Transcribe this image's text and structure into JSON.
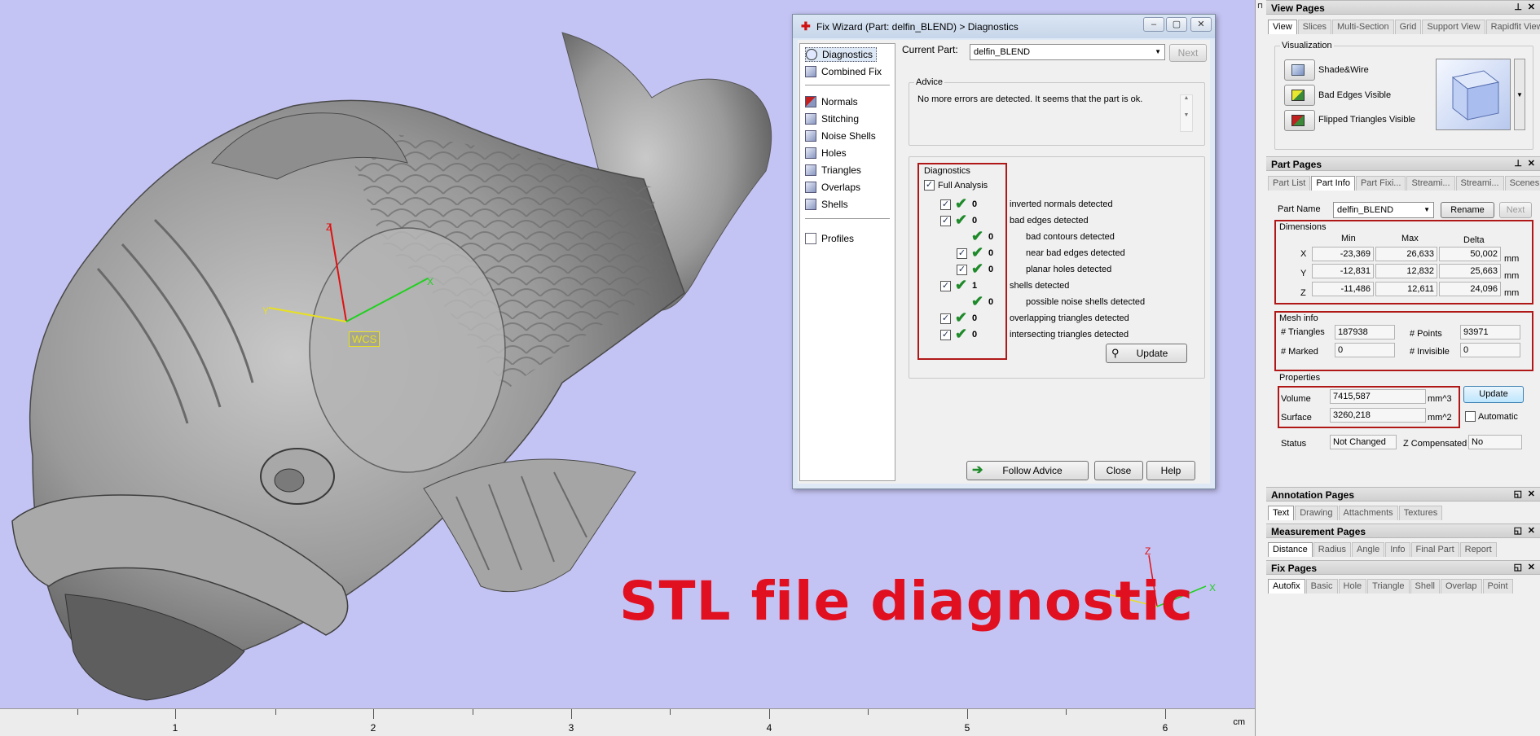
{
  "viewport": {
    "caption": "STL file diagnostic",
    "wcs_label": "WCS",
    "axis_labels": {
      "main_z": "Z",
      "main_y": "Y",
      "main_x": "X",
      "corner_z": "Z",
      "corner_x": "X"
    },
    "ruler": {
      "numbers": [
        "1",
        "2",
        "3",
        "4",
        "5",
        "6"
      ],
      "unit": "cm"
    }
  },
  "wizard": {
    "title": "Fix Wizard (Part: delfin_BLEND) > Diagnostics",
    "nav": [
      {
        "label": "Diagnostics",
        "icon": "magnifier-icon"
      },
      {
        "label": "Combined Fix",
        "icon": "cube-icon"
      },
      {
        "label": "Normals",
        "icon": "normals-icon"
      },
      {
        "label": "Stitching",
        "icon": "stitching-icon"
      },
      {
        "label": "Noise Shells",
        "icon": "noise-shells-icon"
      },
      {
        "label": "Holes",
        "icon": "holes-icon"
      },
      {
        "label": "Triangles",
        "icon": "triangles-icon"
      },
      {
        "label": "Overlaps",
        "icon": "overlaps-icon"
      },
      {
        "label": "Shells",
        "icon": "shells-icon"
      },
      {
        "label": "Profiles",
        "icon": "profiles-icon"
      }
    ],
    "current_part_label": "Current Part:",
    "current_part": "delfin_BLEND",
    "next_label": "Next",
    "advice_title": "Advice",
    "advice_text": "No more errors are detected. It seems that the part is ok.",
    "diagnostics_title": "Diagnostics",
    "full_analysis_label": "Full Analysis",
    "rows": [
      {
        "count": "0",
        "text": "inverted normals detected"
      },
      {
        "count": "0",
        "text": "bad edges detected"
      },
      {
        "count": "0",
        "text": "bad contours detected"
      },
      {
        "count": "0",
        "text": "near bad edges detected"
      },
      {
        "count": "0",
        "text": "planar holes detected"
      },
      {
        "count": "1",
        "text": "shells detected"
      },
      {
        "count": "0",
        "text": "possible noise shells detected"
      },
      {
        "count": "0",
        "text": "overlapping triangles detected"
      },
      {
        "count": "0",
        "text": "intersecting triangles detected"
      }
    ],
    "update_label": "Update",
    "follow_advice_label": "Follow Advice",
    "close_label": "Close",
    "help_label": "Help",
    "colors": {
      "highlight_box": "#b01818",
      "check_green": "#1f8a2a"
    }
  },
  "panel": {
    "view_pages": {
      "title": "View Pages",
      "tabs": [
        "View",
        "Slices",
        "Multi-Section",
        "Grid",
        "Support View",
        "Rapidfit View"
      ],
      "visualization_title": "Visualization",
      "options": [
        "Shade&Wire",
        "Bad Edges Visible",
        "Flipped Triangles Visible"
      ]
    },
    "part_pages": {
      "title": "Part Pages",
      "tabs": [
        "Part List",
        "Part Info",
        "Part Fixi...",
        "Streami...",
        "Streami...",
        "Scenes"
      ],
      "part_name_label": "Part Name",
      "part_name": "delfin_BLEND",
      "rename_label": "Rename",
      "next_label": "Next",
      "dimensions_title": "Dimensions",
      "dim_headers": [
        "Min",
        "Max",
        "Delta"
      ],
      "dims": [
        {
          "axis": "X",
          "min": "-23,369",
          "max": "26,633",
          "delta": "50,002",
          "unit": "mm"
        },
        {
          "axis": "Y",
          "min": "-12,831",
          "max": "12,832",
          "delta": "25,663",
          "unit": "mm"
        },
        {
          "axis": "Z",
          "min": "-11,486",
          "max": "12,611",
          "delta": "24,096",
          "unit": "mm"
        }
      ],
      "mesh_info_title": "Mesh info",
      "triangles_label": "# Triangles",
      "triangles": "187938",
      "points_label": "# Points",
      "points": "93971",
      "marked_label": "# Marked",
      "marked": "0",
      "invisible_label": "# Invisible",
      "invisible": "0",
      "properties_title": "Properties",
      "volume_label": "Volume",
      "volume": "7415,587",
      "volume_unit": "mm^3",
      "surface_label": "Surface",
      "surface": "3260,218",
      "surface_unit": "mm^2",
      "update_label": "Update",
      "automatic_label": "Automatic",
      "status_label": "Status",
      "status": "Not Changed",
      "z_comp_label": "Z Compensated",
      "z_comp": "No"
    },
    "annotation_pages": {
      "title": "Annotation Pages",
      "tabs": [
        "Text",
        "Drawing",
        "Attachments",
        "Textures"
      ]
    },
    "measurement_pages": {
      "title": "Measurement Pages",
      "tabs": [
        "Distance",
        "Radius",
        "Angle",
        "Info",
        "Final Part",
        "Report"
      ]
    },
    "fix_pages": {
      "title": "Fix Pages",
      "tabs": [
        "Autofix",
        "Basic",
        "Hole",
        "Triangle",
        "Shell",
        "Overlap",
        "Point"
      ]
    }
  }
}
